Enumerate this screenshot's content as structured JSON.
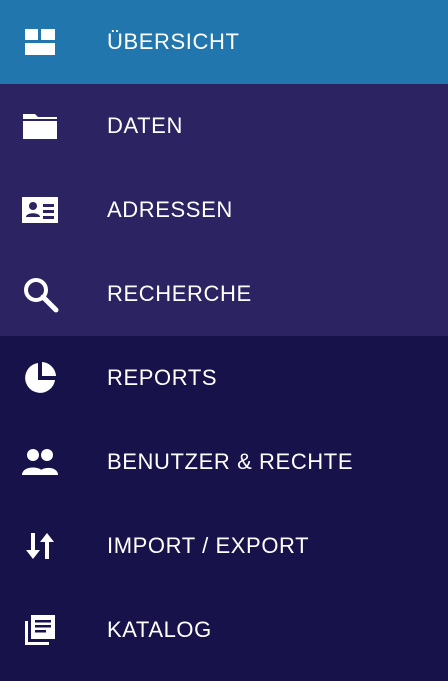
{
  "nav": {
    "items": [
      {
        "label": "ÜBERSICHT",
        "icon": "dashboard-icon",
        "state": "active"
      },
      {
        "label": "DATEN",
        "icon": "folder-icon",
        "state": "normal"
      },
      {
        "label": "ADRESSEN",
        "icon": "contact-card-icon",
        "state": "normal"
      },
      {
        "label": "RECHERCHE",
        "icon": "search-icon",
        "state": "normal"
      },
      {
        "label": "REPORTS",
        "icon": "pie-chart-icon",
        "state": "normal"
      },
      {
        "label": "BENUTZER & RECHTE",
        "icon": "people-icon",
        "state": "normal"
      },
      {
        "label": "IMPORT / EXPORT",
        "icon": "import-export-icon",
        "state": "normal"
      },
      {
        "label": "KATALOG",
        "icon": "library-books-icon",
        "state": "normal"
      }
    ]
  },
  "colors": {
    "active": "#2176ad",
    "group_light": "#2b2362",
    "group_dark": "#18124a",
    "text": "#ffffff"
  }
}
